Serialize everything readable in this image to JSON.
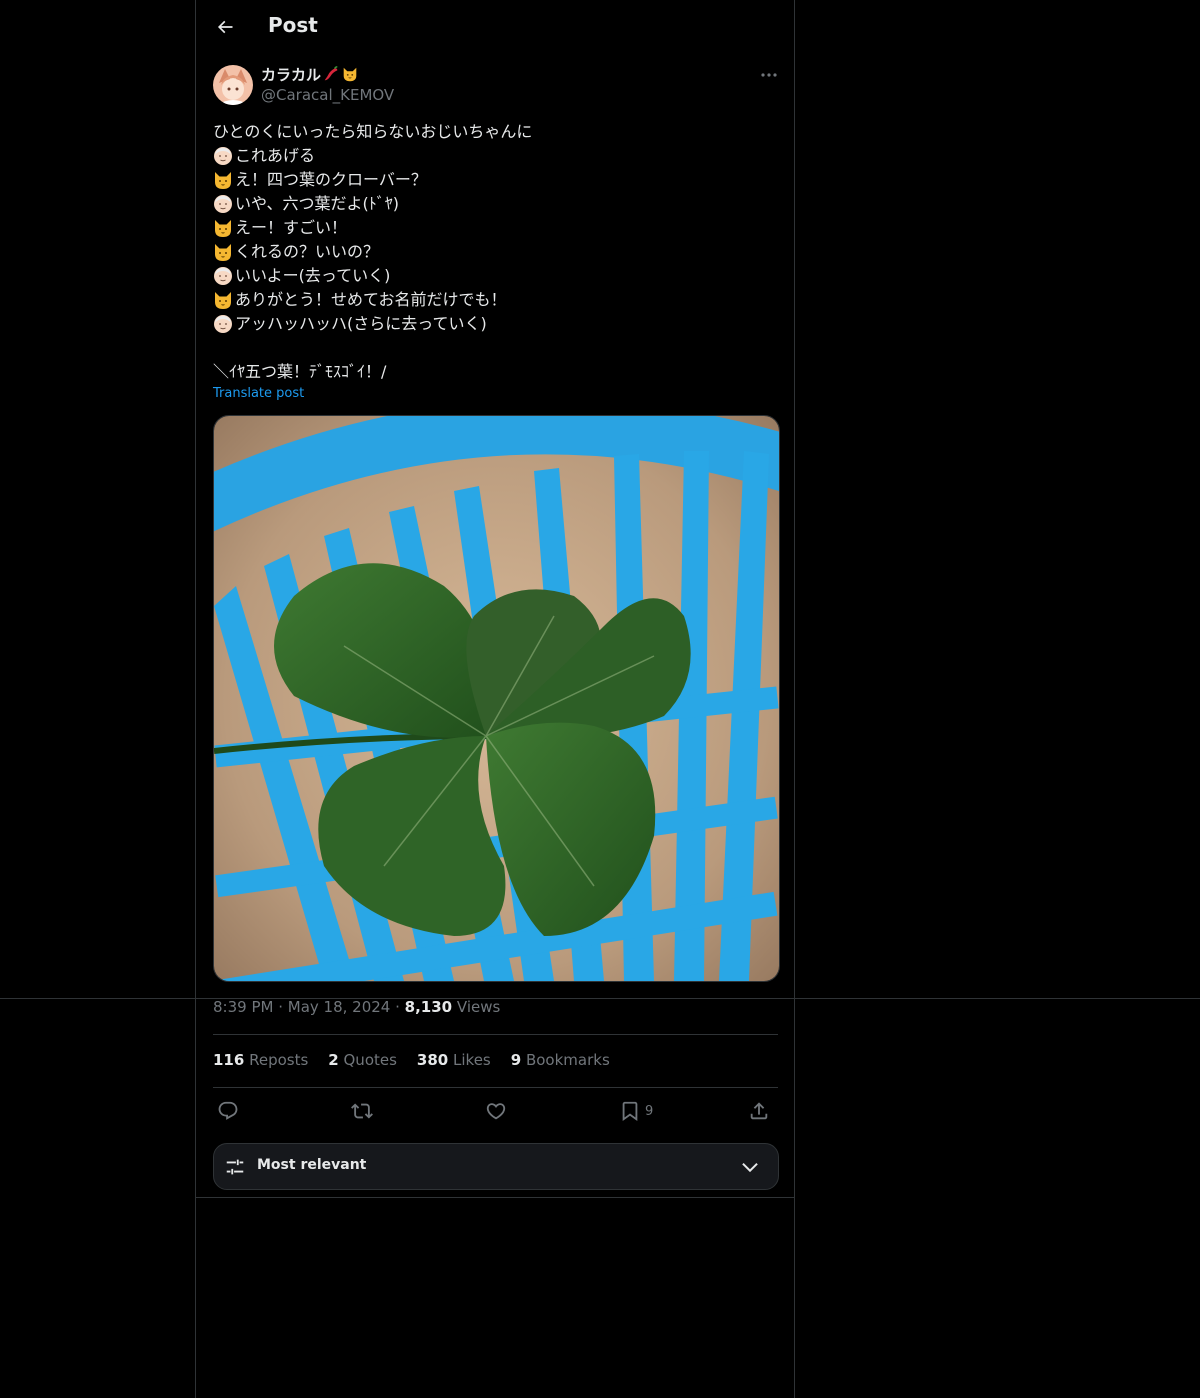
{
  "header": {
    "title": "Post"
  },
  "author": {
    "display_name": "カラカル",
    "handle": "@Caracal_KEMOV"
  },
  "tweet": {
    "lines": [
      {
        "emoji": "",
        "text": "ひとのくにいったら知らないおじいちゃんに"
      },
      {
        "emoji": "old-man",
        "text": "これあげる"
      },
      {
        "emoji": "cat",
        "text": "え！四つ葉のクローバー？"
      },
      {
        "emoji": "old-man",
        "text": "いや、六つ葉だよ(ﾄﾞﾔ)"
      },
      {
        "emoji": "cat",
        "text": "えー！すごい！"
      },
      {
        "emoji": "cat",
        "text": "くれるの？いいの？"
      },
      {
        "emoji": "old-man",
        "text": "いいよー(去っていく)"
      },
      {
        "emoji": "cat",
        "text": "ありがとう！せめてお名前だけでも！"
      },
      {
        "emoji": "old-man",
        "text": "アッハッハッハ(さらに去っていく)"
      },
      {
        "emoji": "",
        "text": ""
      },
      {
        "emoji": "",
        "text": "＼ｲﾔ五つ葉！ﾃﾞﾓｽｺﾞｲ！/"
      }
    ],
    "translate_label": "Translate post"
  },
  "meta": {
    "time": "8:39 PM",
    "date": "May 18, 2024",
    "views_count": "8,130",
    "views_label": "Views"
  },
  "stats": {
    "reposts_count": "116",
    "reposts_label": "Reposts",
    "quotes_count": "2",
    "quotes_label": "Quotes",
    "likes_count": "380",
    "likes_label": "Likes",
    "bookmarks_count": "9",
    "bookmarks_label": "Bookmarks"
  },
  "actions": {
    "bookmark_count": "9"
  },
  "sort": {
    "label": "Most relevant"
  },
  "colors": {
    "background": "#000000",
    "text": "#e7e9ea",
    "muted": "#71767b",
    "accent": "#1d9bf0",
    "border": "#2f3336"
  }
}
